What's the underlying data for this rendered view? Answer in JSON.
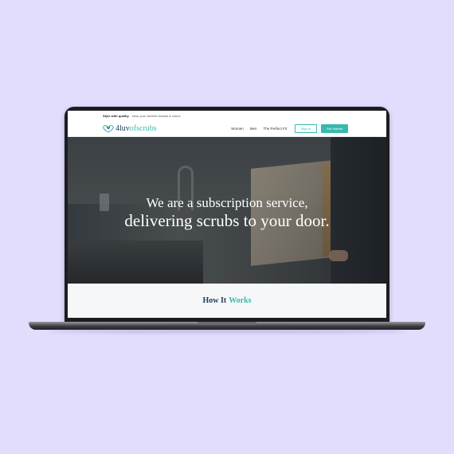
{
  "promo": {
    "bold": "Style with quality",
    "text": ": shop your favorite brands & colors"
  },
  "logo": {
    "part1": "4luv",
    "part2": "of",
    "part3": "scrubs"
  },
  "nav": {
    "women": "Women",
    "men": "Men",
    "perfect_fit": "The Perfect Fit"
  },
  "buttons": {
    "sign_in": "Sign In",
    "get_started": "Get Started"
  },
  "hero": {
    "line1": "We are a subscription service,",
    "line2": "delivering scrubs to your door."
  },
  "how": {
    "word1": "How It",
    "word2": "Works"
  },
  "colors": {
    "background": "#e2dcfd",
    "accent": "#38b8ae",
    "brand_navy": "#1f3a5a"
  }
}
